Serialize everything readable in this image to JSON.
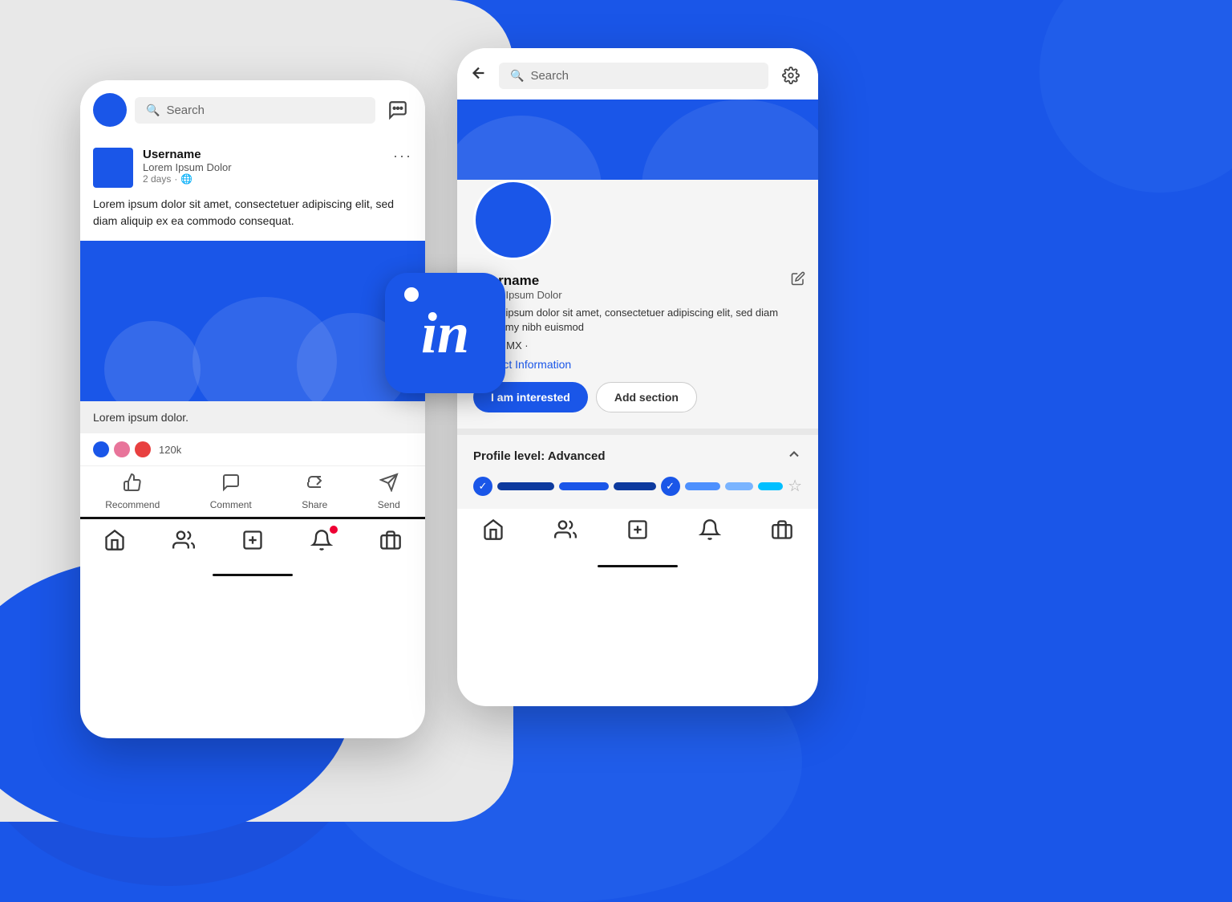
{
  "background": {
    "color": "#1a56e8"
  },
  "linkedin_badge": {
    "logo_text": "in"
  },
  "feed_phone": {
    "search_placeholder": "Search",
    "post": {
      "username": "Username",
      "subtitle": "Lorem Ipsum Dolor",
      "time": "2 days",
      "dots": "···",
      "text": "Lorem ipsum dolor sit amet, consectetuer adipiscing elit, sed diam aliquip ex ea commodo consequat.",
      "caption": "Lorem ipsum dolor.",
      "reaction_count": "120k"
    },
    "actions": {
      "recommend": "Recommend",
      "comment": "Comment",
      "share": "Share",
      "send": "Send"
    },
    "nav": {
      "home": "⌂",
      "people": "👥",
      "add": "+",
      "bell": "🔔",
      "briefcase": "💼"
    }
  },
  "profile_phone": {
    "search_placeholder": "Search",
    "username": "Username",
    "subtitle": "Lorem Ipsum Dolor",
    "description": "Lorem ipsum dolor sit amet, consectetuer adipiscing elit, sed diam nonummy nibh euismod",
    "location": "Cdmx. MX ·",
    "contact_link": "Contact Information",
    "btn_interested": "I am interested",
    "btn_add_section": "Add section",
    "profile_level": {
      "title": "Profile level: Advanced",
      "star": "☆"
    },
    "nav": {
      "home": "⌂",
      "people": "👥",
      "add": "+",
      "bell": "🔔",
      "briefcase": "💼"
    }
  }
}
